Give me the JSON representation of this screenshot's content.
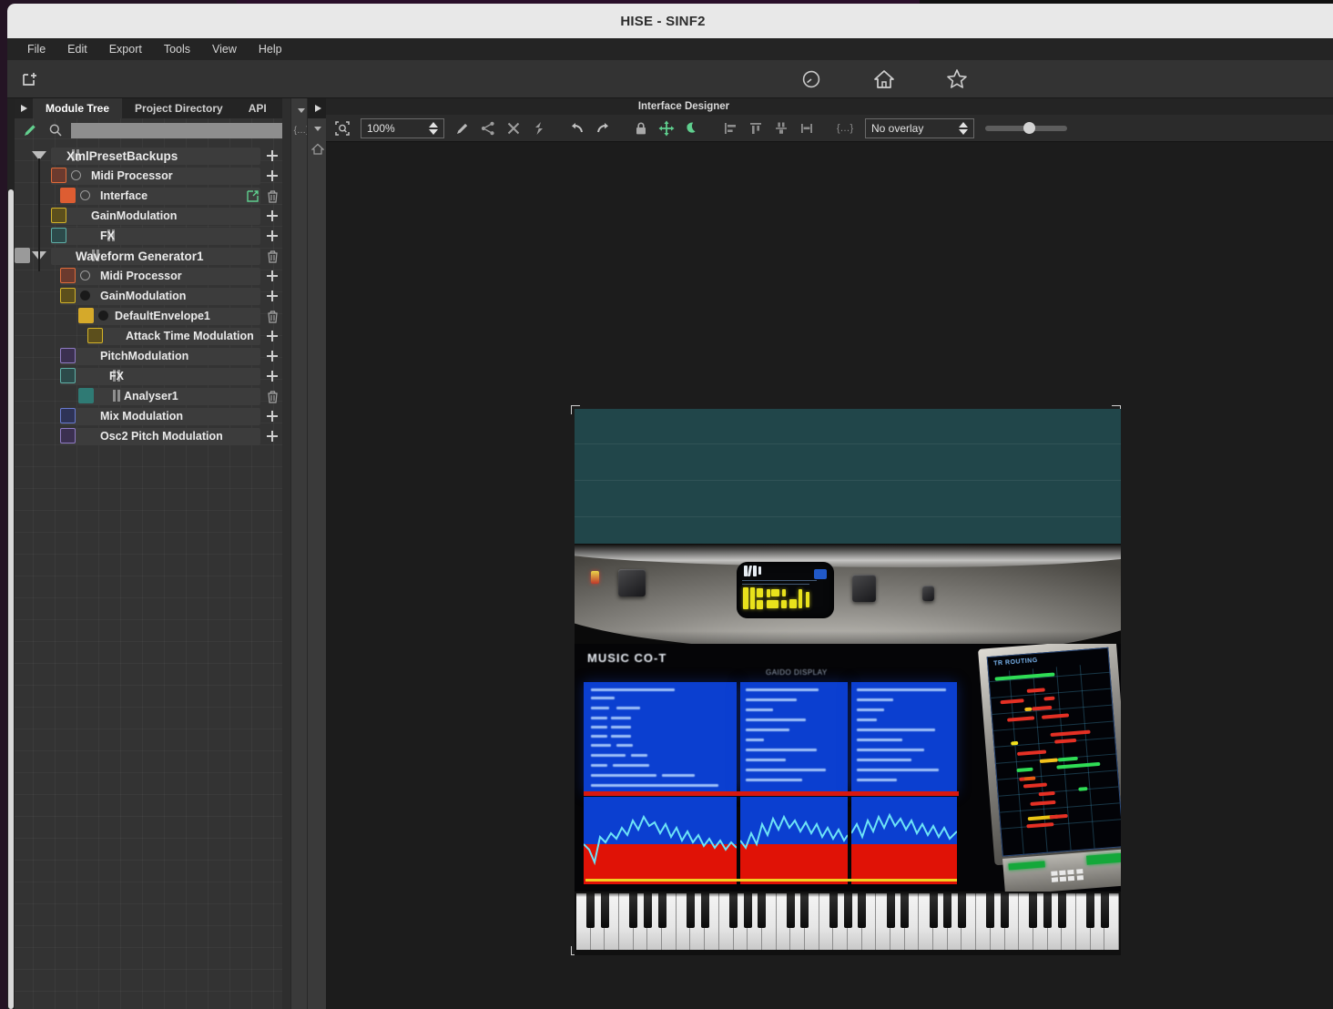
{
  "window": {
    "title": "HISE - SINF2"
  },
  "menubar": {
    "items": [
      {
        "label": "File"
      },
      {
        "label": "Edit"
      },
      {
        "label": "Export"
      },
      {
        "label": "Tools"
      },
      {
        "label": "View"
      },
      {
        "label": "Help"
      }
    ]
  },
  "main_toolbar": {
    "icons": [
      {
        "name": "new-project-icon",
        "title": "New Project"
      },
      {
        "name": "meter-icon",
        "title": "CPU Meter"
      },
      {
        "name": "home-icon",
        "title": "Home"
      },
      {
        "name": "star-icon",
        "title": "Favourites"
      }
    ]
  },
  "left_panel": {
    "tabs": [
      {
        "label": "Module Tree",
        "active": true
      },
      {
        "label": "Project Directory",
        "active": false
      },
      {
        "label": "API",
        "active": false
      }
    ],
    "search": {
      "value": "",
      "placeholder": ""
    },
    "tree": [
      {
        "label": "XmlPresetBackups",
        "indent": 0,
        "bold": true,
        "swatch": null,
        "bars": true,
        "disc": null,
        "action": "add",
        "triangle": true
      },
      {
        "label": "Midi Processor",
        "indent": 1,
        "bold": false,
        "swatch": "#6b3a2e",
        "swatch_border": "#e06c3a",
        "bars": false,
        "disc": "hollow",
        "action": "add",
        "triangle": false
      },
      {
        "label": "Interface",
        "indent": 2,
        "bold": false,
        "swatch": "#dd5d32",
        "swatch_border": "#dd5d32",
        "bars": false,
        "disc": "hollow",
        "action": "external",
        "triangle": false
      },
      {
        "label": "GainModulation",
        "indent": 1,
        "bold": false,
        "swatch": "#5c4f1c",
        "swatch_border": "#d5b429",
        "bars": false,
        "disc": null,
        "action": "add",
        "triangle": false
      },
      {
        "label": "FX",
        "indent": 1,
        "bold": false,
        "swatch": "#2c4a4a",
        "swatch_border": "#5fb0a8",
        "bars": true,
        "disc": null,
        "action": "add",
        "triangle": false
      },
      {
        "label": "Waveform Generator1",
        "indent": 0,
        "bold": true,
        "swatch": "#9a9a9a",
        "swatch_border": "#9a9a9a",
        "bars": true,
        "disc": null,
        "action": "delete",
        "triangle": true
      },
      {
        "label": "Midi Processor",
        "indent": 2,
        "bold": false,
        "swatch": "#6b3a2e",
        "swatch_border": "#e06c3a",
        "bars": false,
        "disc": "hollow",
        "action": "add",
        "triangle": false
      },
      {
        "label": "GainModulation",
        "indent": 2,
        "bold": false,
        "swatch": "#5c4f1c",
        "swatch_border": "#d5b429",
        "bars": false,
        "disc": "filled",
        "action": "add",
        "triangle": false
      },
      {
        "label": "DefaultEnvelope1",
        "indent": 3,
        "bold": false,
        "swatch": "#d5a92a",
        "swatch_border": "#d5a92a",
        "bars": false,
        "disc": "filled",
        "action": "delete",
        "triangle": false
      },
      {
        "label": "Attack Time Modulation",
        "indent": 4,
        "bold": false,
        "swatch": "#5c4f1c",
        "swatch_border": "#d5b429",
        "bars": false,
        "disc": null,
        "action": "add",
        "triangle": false
      },
      {
        "label": "PitchModulation",
        "indent": 2,
        "bold": false,
        "swatch": "#3b3050",
        "swatch_border": "#8f7bc4",
        "bars": false,
        "disc": null,
        "action": "add",
        "triangle": false
      },
      {
        "label": "FX",
        "indent": 2,
        "bold": false,
        "swatch": "#2c4a4a",
        "swatch_border": "#5fb0a8",
        "bars": true,
        "disc": null,
        "action": "add",
        "triangle": false
      },
      {
        "label": "Analyser1",
        "indent": 3,
        "bold": false,
        "swatch": "#2f7a74",
        "swatch_border": "#2f7a74",
        "bars": true,
        "disc": null,
        "action": "delete",
        "triangle": false
      },
      {
        "label": "Mix Modulation",
        "indent": 2,
        "bold": false,
        "swatch": "#2e3356",
        "swatch_border": "#6a7bd0",
        "bars": false,
        "disc": null,
        "action": "add",
        "triangle": false
      },
      {
        "label": "Osc2 Pitch Modulation",
        "indent": 2,
        "bold": false,
        "swatch": "#3b3050",
        "swatch_border": "#8f7bc4",
        "bars": false,
        "disc": null,
        "action": "add",
        "triangle": false
      }
    ]
  },
  "vertical_strips": {
    "left_strip_buttons": [
      {
        "name": "collapse-triangle-icon"
      },
      {
        "name": "code-braces-icon",
        "label": "{...}"
      }
    ],
    "right_strip_buttons": [
      {
        "name": "play-triangle-icon"
      },
      {
        "name": "collapse-triangle-icon"
      },
      {
        "name": "home-icon"
      }
    ]
  },
  "interface_designer": {
    "header_title": "Interface Designer",
    "zoom": {
      "value": "100%"
    },
    "overlay": {
      "value": "No overlay"
    },
    "slider": {
      "value": 50
    },
    "toolbar_icons": [
      {
        "name": "zoom-to-fit-icon",
        "title": "Zoom to fit"
      },
      {
        "name": "edit-pencil-icon",
        "title": "Edit mode"
      },
      {
        "name": "share-node-icon",
        "title": "Connect"
      },
      {
        "name": "delete-x-icon",
        "title": "Delete"
      },
      {
        "name": "rebuild-icon",
        "title": "Rebuild"
      },
      {
        "name": "undo-icon",
        "title": "Undo"
      },
      {
        "name": "redo-icon",
        "title": "Redo"
      },
      {
        "name": "lock-icon",
        "title": "Lock"
      },
      {
        "name": "move-icon",
        "title": "Move"
      },
      {
        "name": "night-mode-icon",
        "title": "Night mode"
      },
      {
        "name": "align-left-icon",
        "title": "Align left"
      },
      {
        "name": "align-top-icon",
        "title": "Align top"
      },
      {
        "name": "distribute-vertical-icon",
        "title": "Distribute vertical"
      },
      {
        "name": "distribute-horizontal-icon",
        "title": "Distribute horizontal"
      },
      {
        "name": "code-braces-icon",
        "title": "Show JSON"
      }
    ]
  },
  "plugin_preview": {
    "header_color": "#21464a",
    "brand_text": "MUSIC CO-T",
    "sub_text": "GAIDO  DISPLAY",
    "right_screen_title": "TR ROUTING",
    "keyboard": {
      "white_keys": 38,
      "octaves": 5
    }
  },
  "colors": {
    "accent_green": "#5fcf8e",
    "panel_bg": "#333333",
    "canvas_bg": "#1c1c1c",
    "titlebar_bg": "#e8e8e8",
    "teal_header": "#21464a"
  }
}
